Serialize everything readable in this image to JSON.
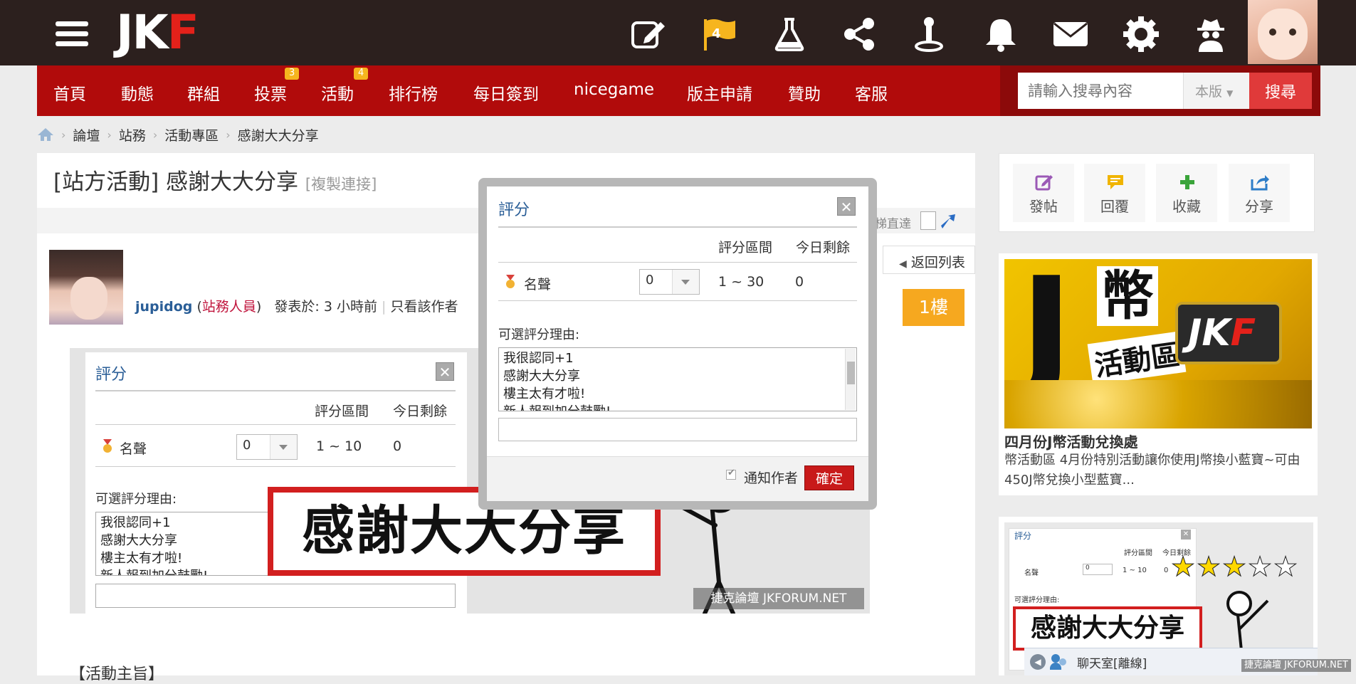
{
  "header": {
    "logo": {
      "jk": "JK",
      "f": "F"
    },
    "icons": [
      "menu-icon",
      "pencil-edit-icon",
      "flag-icon",
      "flask-icon",
      "share-icon",
      "joystick-icon",
      "bell-icon",
      "mail-icon",
      "gear-icon",
      "spy-icon"
    ],
    "flag_badge": "4"
  },
  "nav": {
    "items": [
      "首頁",
      "動態",
      "群組",
      "投票",
      "活動",
      "排行榜",
      "每日簽到",
      "nicegame",
      "版主申請",
      "贊助",
      "客服"
    ],
    "badges": {
      "vote": "3",
      "activity": "4"
    }
  },
  "search": {
    "placeholder": "請輸入搜尋內容",
    "scope": "本版",
    "button": "搜尋"
  },
  "breadcrumb": [
    "論壇",
    "站務",
    "活動專區",
    "感謝大大分享"
  ],
  "thread": {
    "title": "[站方活動] 感謝大大分享",
    "copy_link": "[複製連接]",
    "elevator": "電梯直達",
    "back_to_list": "返回列表",
    "floor": "1樓",
    "author": "jupidog",
    "author_role": "站務人員",
    "posted": "發表於: 3 小時前",
    "only_author": "只看該作者",
    "section_heading": "【活動主旨】"
  },
  "post_image": {
    "dialog_title": "評分",
    "col_range": "評分區間",
    "col_remaining": "今日剩餘",
    "row_label": "名聲",
    "select_value": "0",
    "range": "1 ~ 10",
    "remaining": "0",
    "reason_label": "可選評分理由:",
    "reasons": [
      "我很認同+1",
      "感謝大大分享",
      "樓主太有才啦!",
      "新人報到加分鼓勵!"
    ],
    "banner": "感謝大大分享",
    "watermark": "捷克論壇 JKFORUM.NET"
  },
  "modal": {
    "title": "評分",
    "col_range": "評分區間",
    "col_remaining": "今日剩餘",
    "row_label": "名聲",
    "select_value": "0",
    "range": "1 ~ 30",
    "remaining": "0",
    "reason_label": "可選評分理由:",
    "reasons": [
      "我很認同+1",
      "感謝大大分享",
      "樓主太有才啦!",
      "新人報到加分鼓勵!"
    ],
    "notify_label": "通知作者",
    "confirm": "確定"
  },
  "sidebar": {
    "actions": [
      {
        "label": "發帖",
        "icon": "compose-icon",
        "color": "#9b59b6"
      },
      {
        "label": "回覆",
        "icon": "reply-icon",
        "color": "#f0b400"
      },
      {
        "label": "收藏",
        "icon": "plus-icon",
        "color": "#3aa43a"
      },
      {
        "label": "分享",
        "icon": "share-out-icon",
        "color": "#2e7dc8"
      }
    ],
    "ad": {
      "img_letter": "J",
      "img_text1": "幣",
      "img_text2": "活動區",
      "img_logo": "JKF",
      "title": "四月份J幣活動兌換處",
      "desc": "幣活動區 4月份特別活動讓你使用J幣換小藍寶~可由450J幣兌換小型藍寶..."
    },
    "card2": {
      "dlg_title": "評分",
      "col_range": "評分區間",
      "col_remaining": "今日剩餘",
      "row_label": "名聲",
      "select_value": "0",
      "range": "1 ~ 10",
      "remaining": "0",
      "reason_label": "可選評分理由:",
      "banner": "感謝大大分享",
      "chat_label": "聊天室[離線]",
      "watermark": "捷克論壇 JKFORUM.NET"
    }
  },
  "colors": {
    "topbar": "#2c201e",
    "nav": "#b10b0b",
    "accent_orange": "#f6a81f",
    "link_blue": "#2a5e97",
    "confirm_red": "#c81a1a"
  }
}
